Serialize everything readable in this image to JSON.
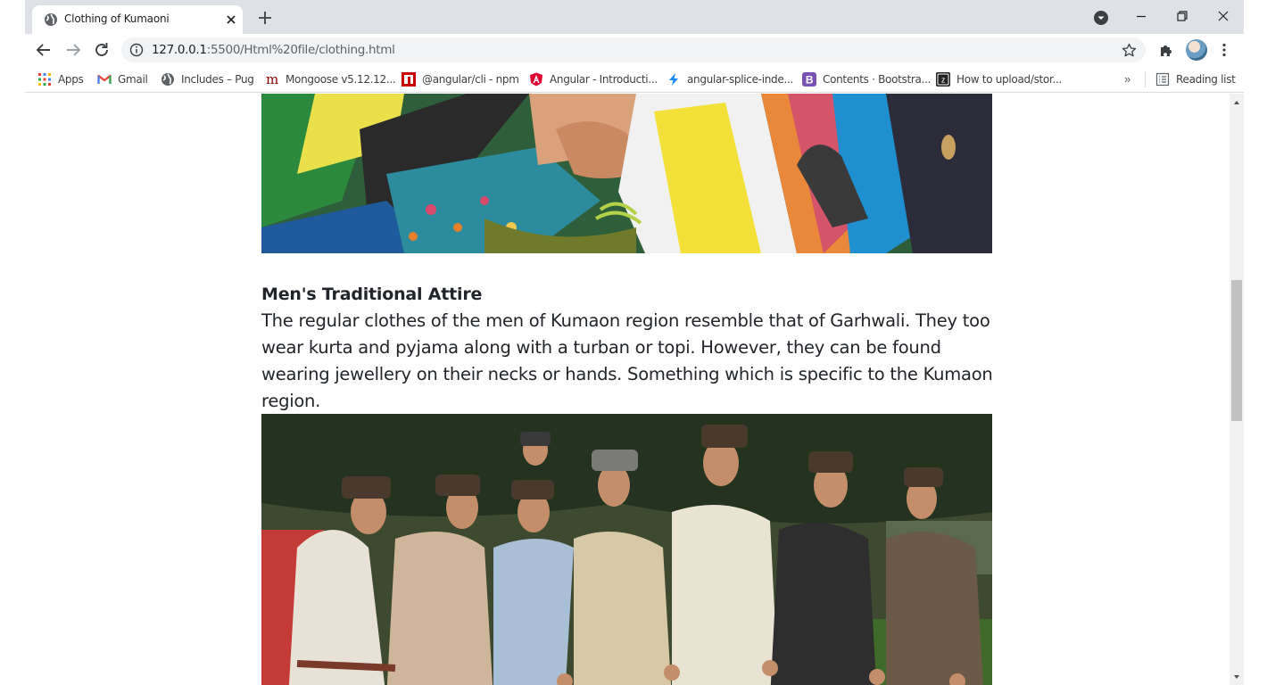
{
  "tab": {
    "title": "Clothing of Kumaoni"
  },
  "address_bar": {
    "host": "127.0.0.1",
    "path": ":5500/Html%20file/clothing.html"
  },
  "bookmarks": [
    {
      "label": "Apps",
      "icon": "apps-grid-icon"
    },
    {
      "label": "Gmail",
      "icon": "gmail-icon"
    },
    {
      "label": "Includes – Pug",
      "icon": "globe-icon"
    },
    {
      "label": "Mongoose v5.12.12...",
      "icon": "mongoose-icon"
    },
    {
      "label": "@angular/cli - npm",
      "icon": "npm-icon"
    },
    {
      "label": "Angular - Introducti...",
      "icon": "angular-icon"
    },
    {
      "label": "angular-splice-inde...",
      "icon": "lightning-icon"
    },
    {
      "label": "Contents · Bootstra...",
      "icon": "bootstrap-icon"
    },
    {
      "label": "How to upload/stor...",
      "icon": "z-icon"
    }
  ],
  "reading_list": {
    "label": "Reading list"
  },
  "article": {
    "heading": "Men's Traditional Attire",
    "paragraph": "The regular clothes of the men of Kumaon region resemble that of Garhwali. They too wear kurta and pyjama along with a turban or topi. However, they can be found wearing jewellery on their necks or hands. Something which is specific to the Kumaon region."
  }
}
